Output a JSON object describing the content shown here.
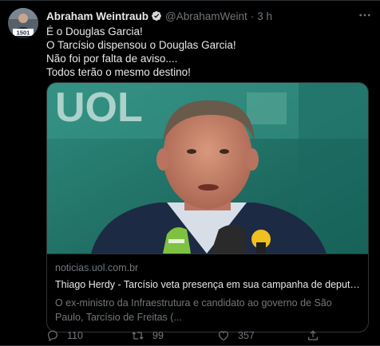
{
  "tweet": {
    "author": {
      "display_name": "Abraham Weintraub",
      "handle": "@AbrahamWeint",
      "verified": true,
      "avatar_badge": "1501"
    },
    "separator": "·",
    "time": "3 h",
    "lines": [
      "É o Douglas Garcia!",
      "O Tarcísio dispensou o Douglas Garcia!",
      "Não foi por falta de aviso....",
      "Todos terão o mesmo destino!"
    ],
    "card": {
      "image_logo_text": "UOL",
      "domain": "noticias.uol.com.br",
      "title": "Thiago Herdy - Tarcísio veta presença em sua campanha de deputado...",
      "description": "O ex-ministro da Infraestrutura e candidato ao governo de São Paulo, Tarcísio de Freitas (..."
    },
    "actions": {
      "replies": "110",
      "retweets": "99",
      "likes": "357"
    }
  },
  "colors": {
    "background": "#000000",
    "text_primary": "#e7e9ea",
    "text_secondary": "#71767b",
    "border": "#2f3336",
    "verified": "#1d9bf0",
    "uol_green": "#1f7a6e"
  },
  "icons": [
    "verified-icon",
    "more-icon",
    "reply-icon",
    "retweet-icon",
    "like-icon",
    "share-icon"
  ]
}
